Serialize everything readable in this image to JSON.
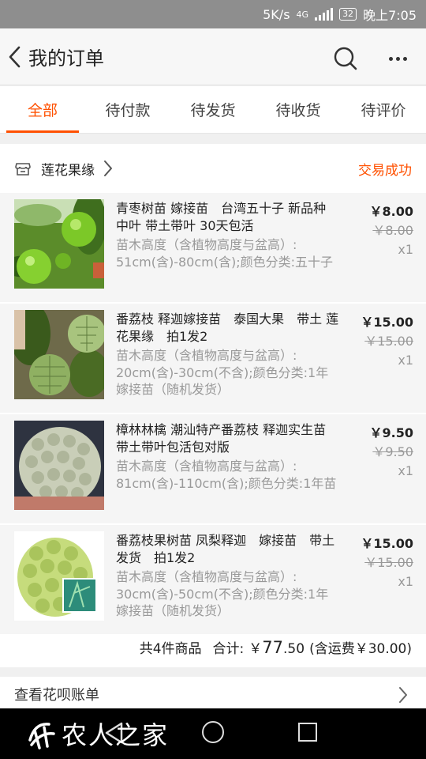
{
  "status_bar": {
    "speed": "5K/s",
    "network": "4G",
    "battery": "32",
    "time": "晚上7:05"
  },
  "header": {
    "title": "我的订单",
    "back_icon": "chevron-left-icon",
    "search_icon": "search-icon",
    "more_icon": "more-dots-icon"
  },
  "tabs": [
    {
      "label": "全部",
      "active": true
    },
    {
      "label": "待付款",
      "active": false
    },
    {
      "label": "待发货",
      "active": false
    },
    {
      "label": "待收货",
      "active": false
    },
    {
      "label": "待评价",
      "active": false
    }
  ],
  "order": {
    "shop_name": "莲花果缘",
    "status": "交易成功",
    "items": [
      {
        "title": "青枣树苗 嫁接苗　台湾五十子 新品种 中叶 带土带叶 30天包活",
        "spec": "苗木高度（含植物高度与盆高）: 51cm(含)-80cm(含);颜色分类:五十子",
        "price": "￥8.00",
        "original_price": "￥8.00",
        "qty": "x1"
      },
      {
        "title": "番荔枝 释迦嫁接苗　泰国大果　带土 莲花果缘　拍1发2",
        "spec": "苗木高度（含植物高度与盆高）: 20cm(含)-30cm(不含);颜色分类:1年嫁接苗（随机发货）",
        "price": "￥15.00",
        "original_price": "￥15.00",
        "qty": "x1"
      },
      {
        "title": "樟林林檎 潮汕特产番荔枝 释迦实生苗 带土带叶包活包对版",
        "spec": "苗木高度（含植物高度与盆高）: 81cm(含)-110cm(含);颜色分类:1年苗",
        "price": "￥9.50",
        "original_price": "￥9.50",
        "qty": "x1"
      },
      {
        "title": "番荔枝果树苗 凤梨释迦　嫁接苗　带土发货　拍1发2",
        "spec": "苗木高度（含植物高度与盆高）: 30cm(含)-50cm(不含);颜色分类:1年嫁接苗（随机发货）",
        "price": "￥15.00",
        "original_price": "￥15.00",
        "qty": "x1"
      }
    ],
    "summary": {
      "count_text": "共4件商品",
      "total_label": "合计:",
      "currency": "￥",
      "total_int": "77",
      "total_dec": ".50",
      "shipping": "(含运费￥30.00)"
    }
  },
  "bill_link": "查看花呗账单",
  "watermark": "农人之家",
  "colors": {
    "accent": "#ff5000",
    "muted": "#999999"
  }
}
